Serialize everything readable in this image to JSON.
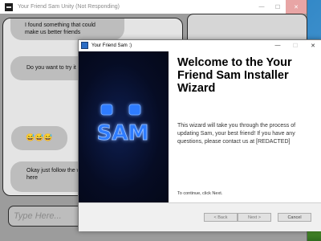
{
  "colors": {
    "desktop": "#2f86c6",
    "back_window": "#9c9c9c",
    "bubble": "#bdbdbd",
    "banner": "#060c24",
    "logo_glow": "#2f7bff"
  },
  "back_window": {
    "title": "Your Friend Sam Unity (Not Responding)",
    "controls": {
      "minimize": "—",
      "maximize": "☐",
      "close": "✕"
    }
  },
  "chat": {
    "messages": [
      {
        "text": "I found something that could make us better friends"
      },
      {
        "text": "Do you want to try it"
      },
      {
        "text": "😅😅😅"
      },
      {
        "text": "Okay just follow the wizard here"
      }
    ],
    "input": {
      "placeholder": "Type Here..."
    }
  },
  "installer": {
    "title": "Your Friend Sam :)",
    "controls": {
      "minimize": "—",
      "maximize": "☐",
      "close": "✕"
    },
    "logo": {
      "eyes": "oo",
      "mouth": "SAM"
    },
    "heading": "Welcome to the Your Friend Sam Installer Wizard",
    "description": "This wizard will take you through the process of updating Sam, your best friend! If you have any questions, please contact us at [REDACTED]",
    "continue_text": "To continue, click Next.",
    "buttons": {
      "back": "< Back",
      "next": "Next >",
      "cancel": "Cancel"
    }
  }
}
